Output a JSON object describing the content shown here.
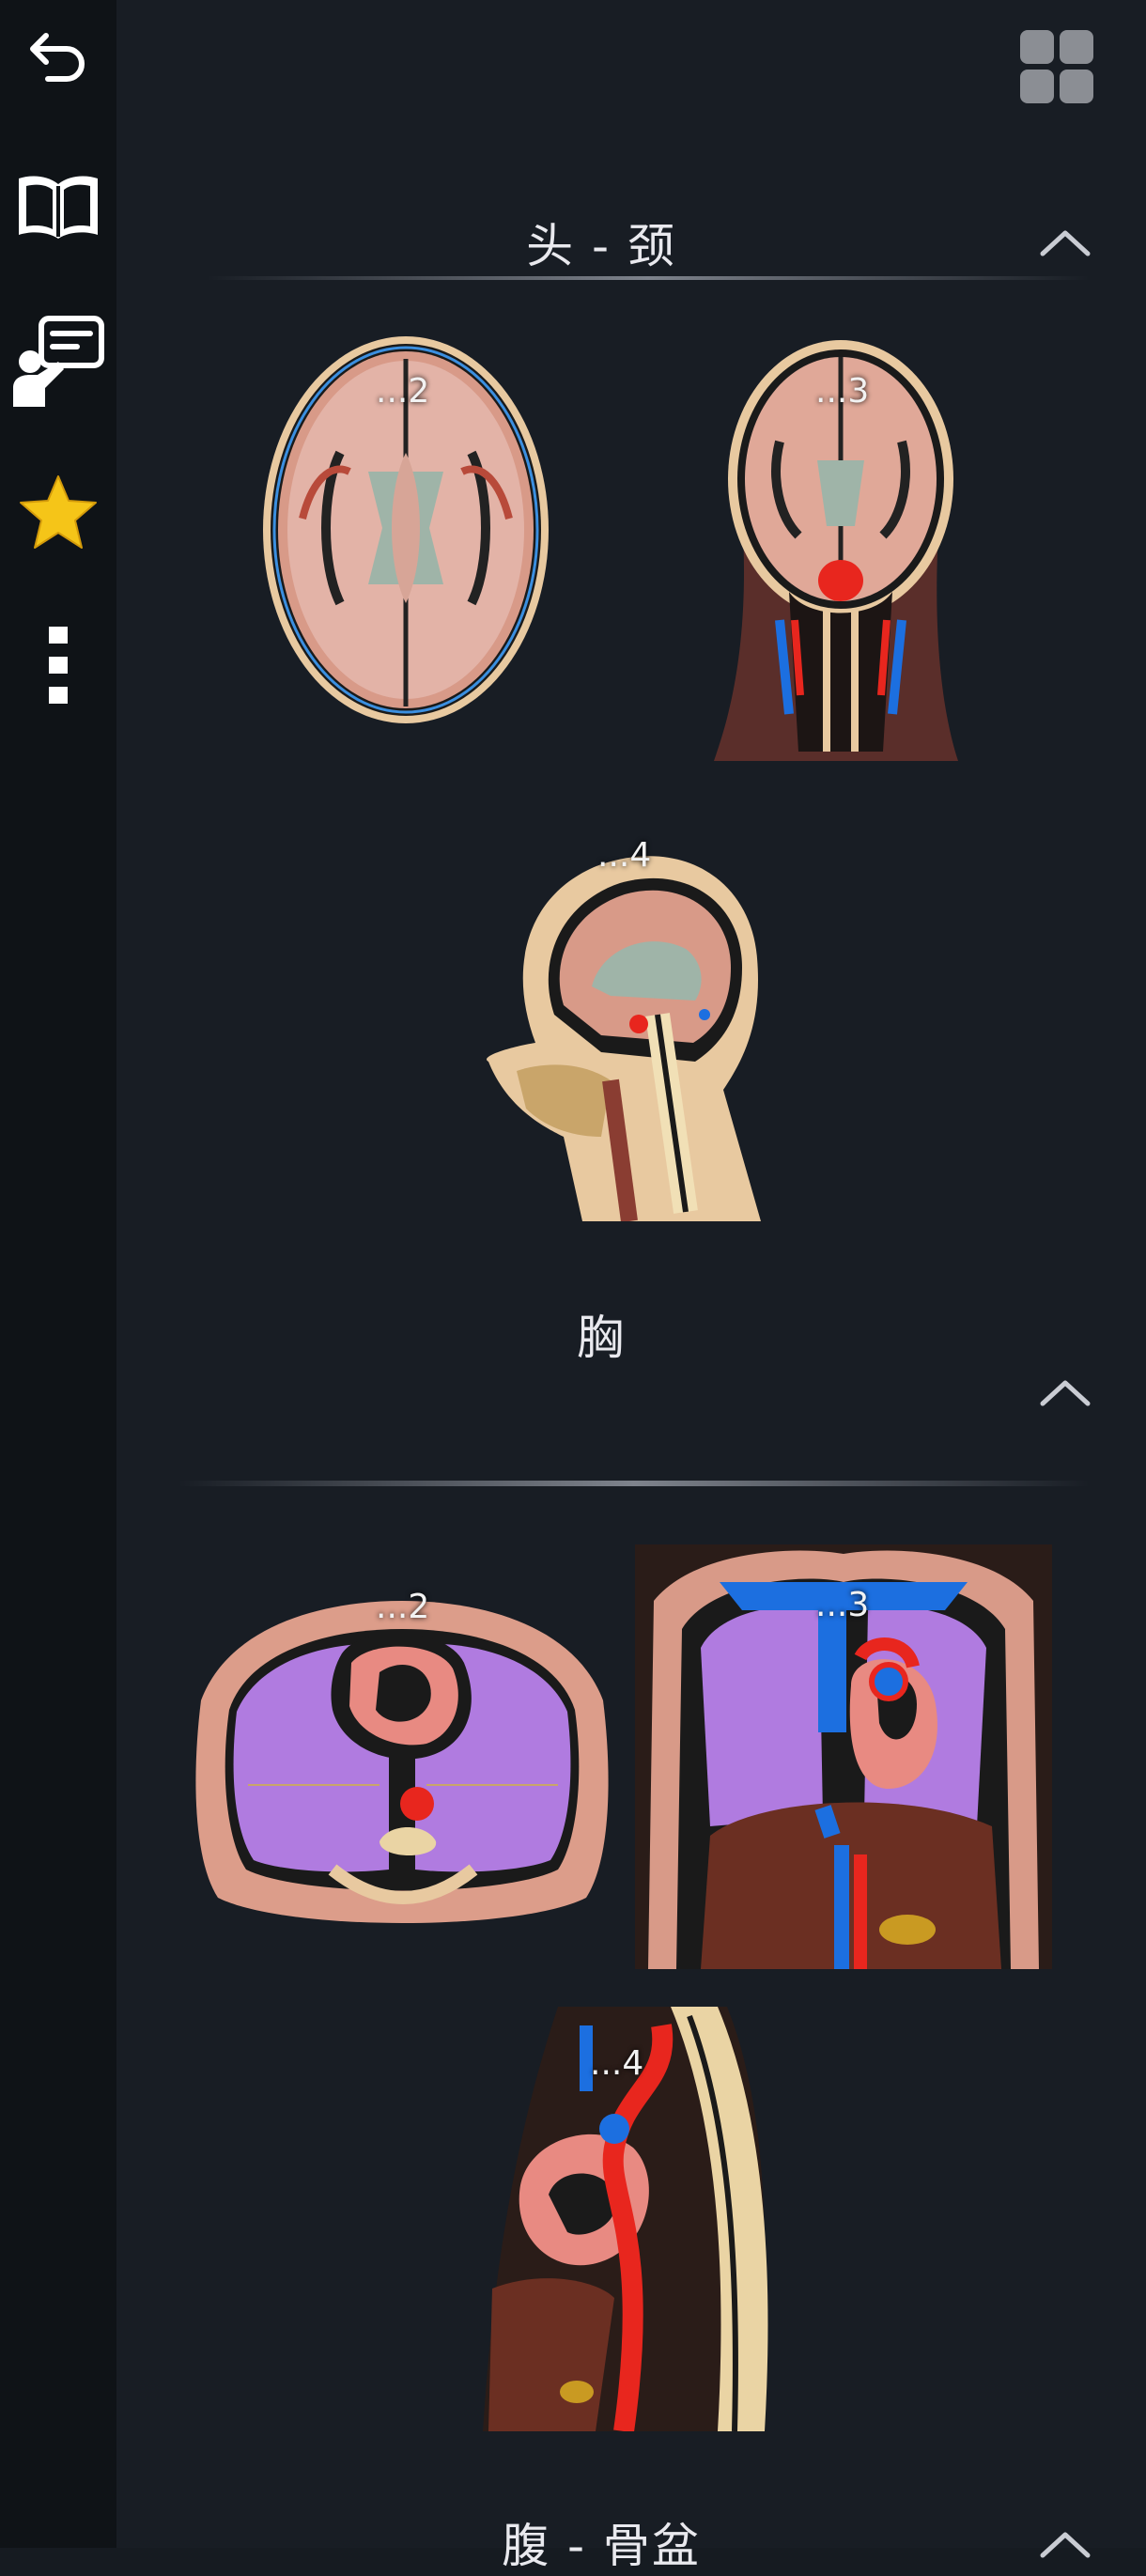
{
  "sidebar": {
    "back": "back-icon",
    "book": "book-icon",
    "quiz": "quiz-icon",
    "favorites": "star-icon",
    "more": "more-vertical-icon"
  },
  "top": {
    "view_toggle": "grid-view-icon"
  },
  "sections": [
    {
      "title": "头 - 颈",
      "items": [
        {
          "label": "...2"
        },
        {
          "label": "...3"
        },
        {
          "label": "...4"
        }
      ]
    },
    {
      "title": "胸",
      "items": [
        {
          "label": "...2"
        },
        {
          "label": "...3"
        },
        {
          "label": "...4"
        }
      ]
    },
    {
      "title": "腹 - 骨盆"
    }
  ],
  "colors": {
    "background": "#181d24",
    "sidebar": "#0f1317",
    "star": "#f5c518",
    "lung": "#b07be0",
    "artery": "#e8261e",
    "vein": "#1c6fe0"
  }
}
